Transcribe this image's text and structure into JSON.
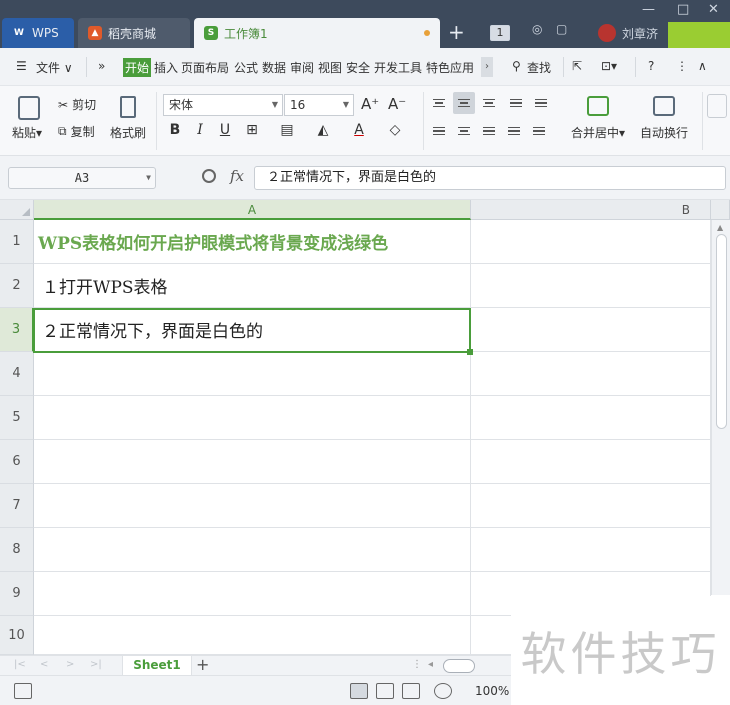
{
  "tabs": {
    "wps": "WPS",
    "shop": "稻壳商城",
    "workbook": "工作簿1",
    "new_tab": "+",
    "window_count": "1",
    "user": "刘章济"
  },
  "menu": {
    "file": "文件",
    "items": [
      "开始",
      "插入",
      "页面布局",
      "公式",
      "数据",
      "审阅",
      "视图",
      "安全",
      "开发工具",
      "特色应用"
    ],
    "search": "查找"
  },
  "ribbon": {
    "paste": "粘贴",
    "cut": "剪切",
    "copy": "复制",
    "format_painter": "格式刷",
    "font": "宋体",
    "size": "16",
    "grow": "A⁺",
    "shrink": "A⁻",
    "bold": "B",
    "italic": "I",
    "underline": "U",
    "merge_center": "合并居中",
    "wrap": "自动换行"
  },
  "formula": {
    "namebox": "A3",
    "fx": "fx",
    "content": "２正常情况下，界面是白色的"
  },
  "columns": [
    "A",
    "B"
  ],
  "rows": [
    "1",
    "2",
    "3",
    "4",
    "5",
    "6",
    "7",
    "8",
    "9",
    "10"
  ],
  "cells": {
    "a1": "WPS表格如何开启护眼模式将背景变成浅绿色",
    "a2": "１打开WPS表格",
    "a3": "２正常情况下，界面是白色的"
  },
  "sheet": {
    "name": "Sheet1",
    "add": "+"
  },
  "status": {
    "zoom": "100%"
  },
  "watermark": "软件技巧",
  "colors": {
    "accent_green": "#4a9d3b",
    "title_green": "#6aa84f",
    "tabbar": "#3d4a5c"
  }
}
